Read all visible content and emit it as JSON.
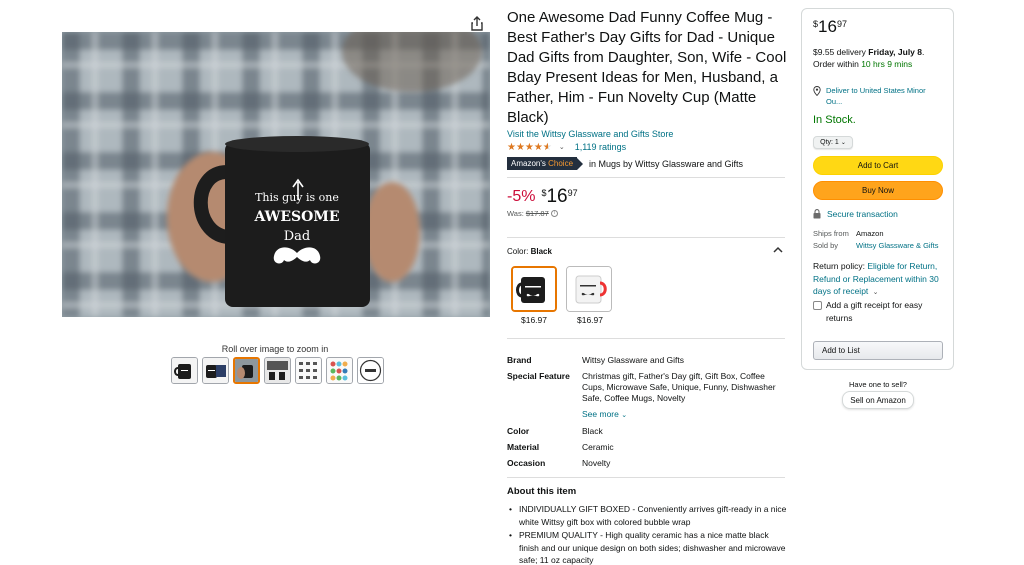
{
  "product": {
    "title": "One Awesome Dad Funny Coffee Mug - Best Father's Day Gifts for Dad - Unique Dad Gifts from Daughter, Son, Wife - Cool Bday Present Ideas for Men, Husband, a Father, Him - Fun Novelty Cup (Matte Black)",
    "store_link": "Visit the Wittsy Glassware and Gifts Store",
    "rating_stars": 4.5,
    "ratings_count": "1,119 ratings",
    "badge_left": "Amazon's",
    "badge_right": "Choice",
    "badge_category": "in Mugs by Wittsy Glassware and Gifts",
    "discount": "-5%",
    "price_symbol": "$",
    "price_whole": "16",
    "price_fraction": "97",
    "was_label": "Was:",
    "was_price": "$17.87",
    "mug_text_line1": "This guy is one",
    "mug_text_line2": "AWESOME",
    "mug_text_line3": "Dad"
  },
  "gallery": {
    "zoom_hint": "Roll over image to zoom in",
    "thumbnail_count": 7,
    "selected_index": 2
  },
  "color_selector": {
    "label": "Color:",
    "value": "Black",
    "variants": [
      {
        "price": "$16.97",
        "selected": true
      },
      {
        "price": "$16.97",
        "selected": false
      }
    ]
  },
  "specs": [
    {
      "label": "Brand",
      "value": "Wittsy Glassware and Gifts"
    },
    {
      "label": "Special Feature",
      "value": "Christmas gift, Father's Day gift, Gift Box, Coffee Cups, Microwave Safe, Unique, Funny, Dishwasher Safe, Coffee Mugs, Novelty"
    },
    {
      "label": "Color",
      "value": "Black"
    },
    {
      "label": "Material",
      "value": "Ceramic"
    },
    {
      "label": "Occasion",
      "value": "Novelty"
    }
  ],
  "see_more": "See more",
  "about": {
    "title": "About this item",
    "bullets": [
      "INDIVIDUALLY GIFT BOXED - Conveniently arrives gift-ready in a nice white Wittsy gift box with colored bubble wrap",
      "PREMIUM QUALITY - High quality ceramic has a nice matte black finish and our unique design on both sides; dishwasher and microwave safe; 11 oz capacity"
    ]
  },
  "buybox": {
    "price_symbol": "$",
    "price_whole": "16",
    "price_fraction": "97",
    "delivery_prefix": "$9.55 delivery",
    "delivery_date": "Friday, July 8",
    "order_within_prefix": "Order within",
    "order_within_time": "10 hrs 9 mins",
    "deliver_to": "Deliver to United States Minor Ou...",
    "stock": "In Stock.",
    "qty": "Qty: 1",
    "add_to_cart": "Add to Cart",
    "buy_now": "Buy Now",
    "secure": "Secure transaction",
    "ships_from_label": "Ships from",
    "ships_from_value": "Amazon",
    "sold_by_label": "Sold by",
    "sold_by_value": "Wittsy Glassware & Gifts",
    "return_policy_label": "Return policy:",
    "return_policy_value": "Eligible for Return, Refund or Replacement within 30 days of receipt",
    "gift_receipt": "Add a gift receipt for easy returns",
    "add_to_list": "Add to List"
  },
  "sell": {
    "question": "Have one to sell?",
    "button": "Sell on Amazon"
  },
  "colors": {
    "link": "#007185",
    "discount": "#cc0c39",
    "stock": "#007600",
    "star": "#de7921",
    "add_to_cart": "#ffd814",
    "buy_now": "#ffa41c",
    "selected_border": "#e77600"
  },
  "icons": [
    "share-icon",
    "star-icon",
    "chevron-down-icon",
    "info-icon",
    "chevron-up-icon",
    "location-pin-icon",
    "lock-icon",
    "checkbox-icon"
  ]
}
